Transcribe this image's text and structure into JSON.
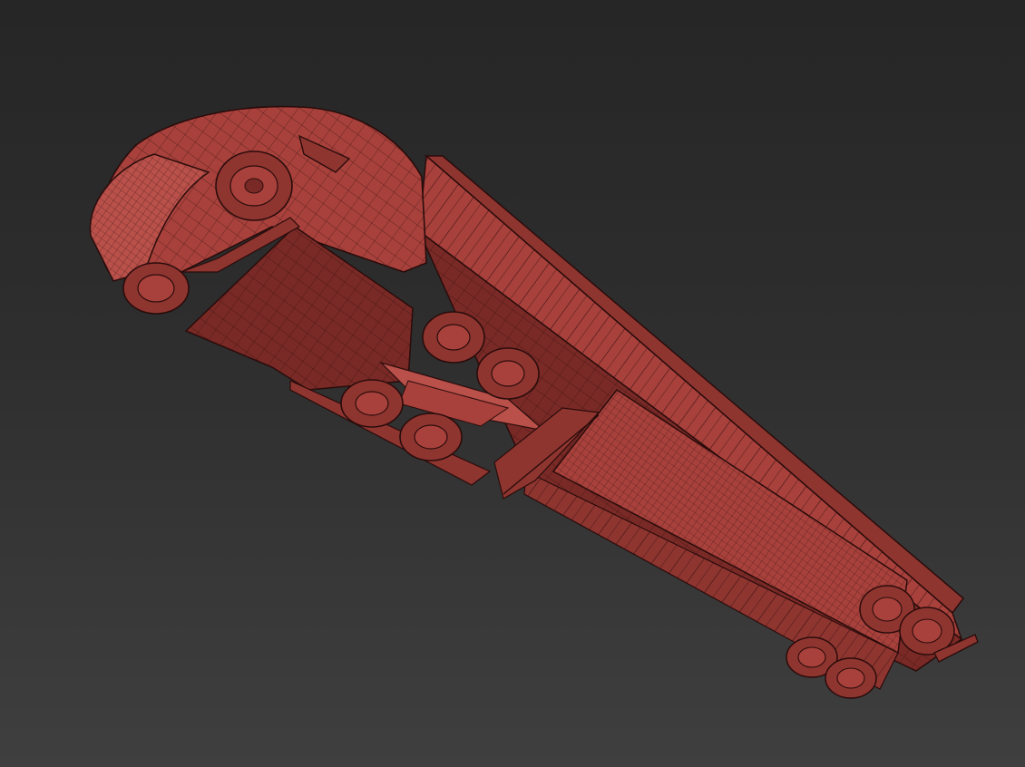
{
  "viewport": {
    "background_top": "#262626",
    "background_bottom": "#3f3f3f"
  },
  "model": {
    "subject": "semi-truck-with-trailer",
    "render_style": "wireframe-on-shaded",
    "colors": {
      "fill": "#a8413c",
      "fill_dark": "#7a2a26",
      "fill_light": "#b9504a",
      "edge": "#2a0c0b"
    }
  }
}
